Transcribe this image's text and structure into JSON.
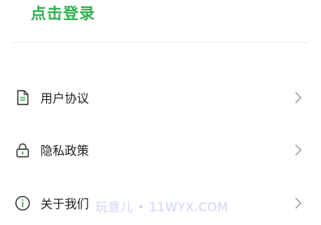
{
  "header": {
    "login_label": "点击登录"
  },
  "menu": {
    "items": [
      {
        "label": "用户协议",
        "icon": "document-icon"
      },
      {
        "label": "隐私政策",
        "icon": "lock-icon"
      },
      {
        "label": "关于我们",
        "icon": "info-icon"
      }
    ]
  },
  "watermark": {
    "text": "玩意儿 • 11WYX.COM"
  },
  "colors": {
    "accent": "#2fb14f",
    "text": "#222222",
    "icon": "#333333",
    "chevron": "#9a9a9a",
    "divider": "#ececec"
  }
}
